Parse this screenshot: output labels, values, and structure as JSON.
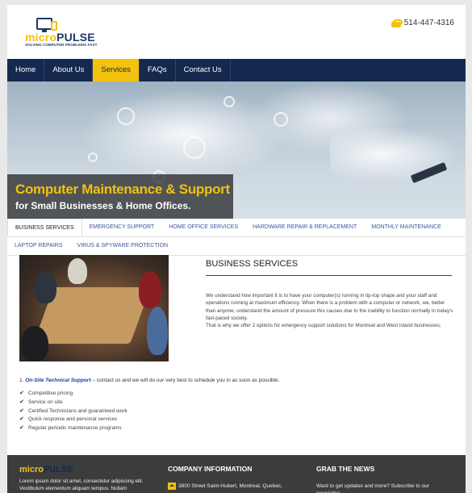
{
  "header": {
    "logo": {
      "brand_part1": "micro",
      "brand_part2": "PULSE",
      "tagline": "SOLVING COMPUTER PROBLEMS FAST"
    },
    "phone": "514-447-4316"
  },
  "nav": {
    "items": [
      {
        "label": "Home"
      },
      {
        "label": "About Us"
      },
      {
        "label": "Services"
      },
      {
        "label": "FAQs"
      },
      {
        "label": "Contact Us"
      }
    ],
    "active": "Services",
    "active_color": "#f2c20c",
    "bg_color": "#14294d"
  },
  "hero": {
    "title": "Computer Maintenance & Support",
    "subtitle": "for Small Businesses & Home Offices."
  },
  "tabs": {
    "row1": [
      {
        "label": "BUSINESS SERVICES"
      },
      {
        "label": "EMERGENCY SUPPORT"
      },
      {
        "label": "HOME OFFICE SERVICES"
      },
      {
        "label": "HARDWARE REPAIR & REPLACEMENT"
      },
      {
        "label": "MONTHLY MAINTENANCE"
      }
    ],
    "row2": [
      {
        "label": "LAPTOP REPAIRS"
      },
      {
        "label": "VIRUS & SPYWARE PROTECTION"
      }
    ],
    "active": "BUSINESS SERVICES"
  },
  "content": {
    "title": "BUSINESS SERVICES",
    "paragraph1": "We understand how important it is to have your computer(s) running in tip-top shape and your staff and operations running at maximum efficiency. When there is a problem with a computer or network, we, better than anyone, understand the amount of pressure this causes due to the inability to function normally in today's fast-paced society.",
    "paragraph2": "That is why we offer 2 options for emergency support solutions for Montreal and West Island businesses;",
    "onsite_prefix": "1. ",
    "onsite_highlight": "On-Site Technical Support",
    "onsite_text": " – contact us and we will do our very best to schedule you in as soon as possible.",
    "checklist": [
      "Competitive pricing",
      "Service on site",
      "Certified Technicians and guaranteed work",
      "Quick response and personal services",
      "Regular periodic maintenance programs"
    ]
  },
  "footer": {
    "logo_part1": "micro",
    "logo_part2": "PULSE",
    "about_text": "Lorem ipsum dolor sit amet, consectetur adipiscing elit. Vestibulum elementum aliquam tempus. Nullam",
    "company_heading": "COMPANY INFORMATION",
    "address": "3800 Street Saint-Hubert, Montreal, Quebec,",
    "news_heading": "GRAB THE NEWS",
    "news_text": "Want to get updates and more? Subscribe to our newsletter."
  }
}
